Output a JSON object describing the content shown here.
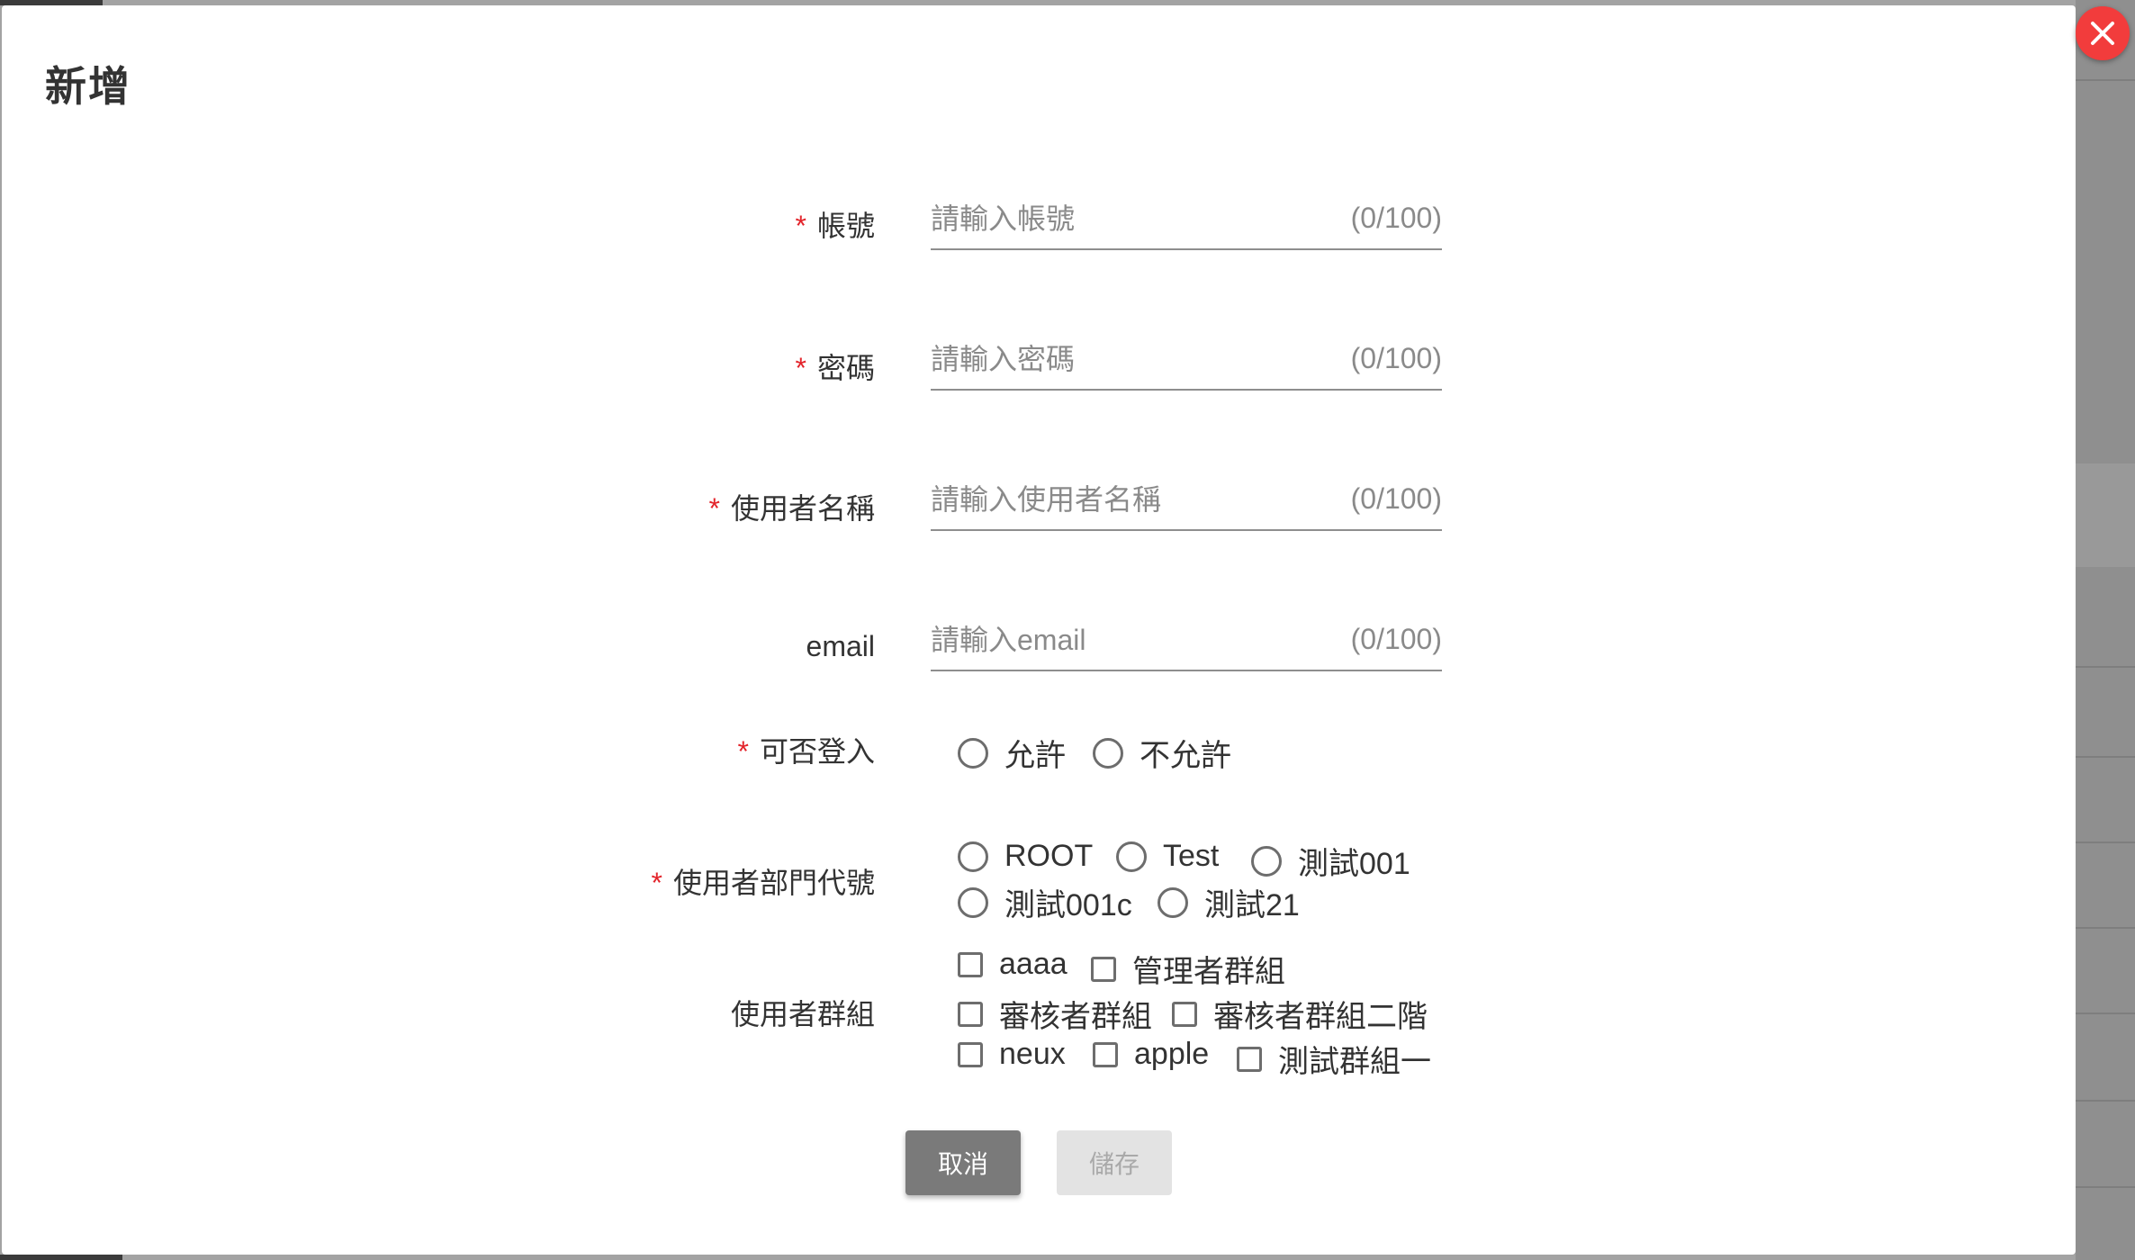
{
  "modal": {
    "title": "新增",
    "close_icon": "close-icon"
  },
  "form": {
    "account": {
      "label": "帳號",
      "required": "*",
      "placeholder": "請輸入帳號",
      "counter": "(0/100)"
    },
    "password": {
      "label": "密碼",
      "required": "*",
      "placeholder": "請輸入密碼",
      "counter": "(0/100)"
    },
    "username": {
      "label": "使用者名稱",
      "required": "*",
      "placeholder": "請輸入使用者名稱",
      "counter": "(0/100)"
    },
    "email": {
      "label": "email",
      "placeholder": "請輸入email",
      "counter": "(0/100)"
    },
    "login_allowed": {
      "label": "可否登入",
      "required": "*",
      "options": [
        "允許",
        "不允許"
      ]
    },
    "department": {
      "label": "使用者部門代號",
      "required": "*",
      "options": [
        "ROOT",
        "Test",
        "測試001",
        "測試001c",
        "測試21"
      ]
    },
    "groups": {
      "label": "使用者群組",
      "options": [
        "aaaa",
        "管理者群組",
        "審核者群組",
        "審核者群組二階",
        "neux",
        "apple",
        "測試群組一"
      ]
    }
  },
  "buttons": {
    "cancel": "取消",
    "save": "儲存"
  },
  "colors": {
    "required": "#e3242b",
    "close": "#f23c3c",
    "cancel_bg": "#7a7a7a",
    "save_bg_disabled": "#e3e3e3"
  }
}
